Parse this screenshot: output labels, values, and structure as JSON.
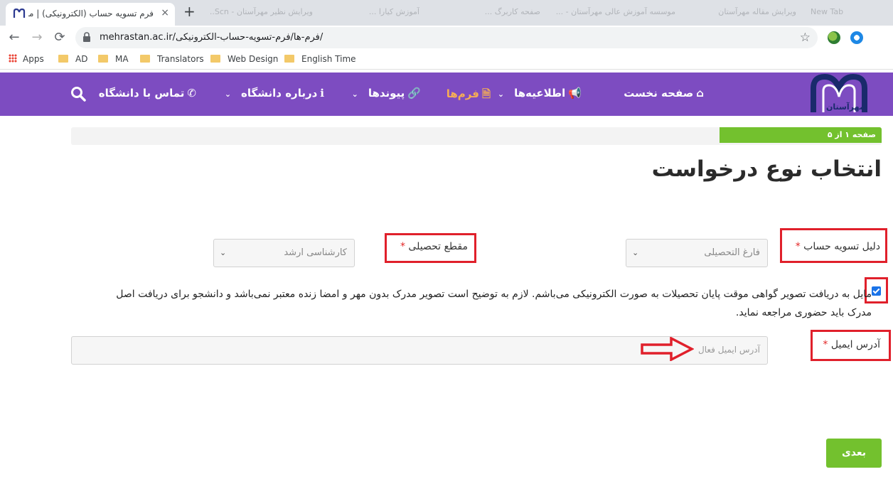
{
  "browser": {
    "active_tab_title": "فرم تسویه حساب (الکترونیکی) | موسسه آمو",
    "tab_close": "×",
    "new_tab": "+",
    "background_tabs": [
      "ویرایش نظیر مهرآستان - Scn..",
      "آموزش کیارا ...",
      "صفحه کاربرگ ...",
      "موسسه آموزش عالی مهرآستان - ...",
      "ویرایش مقاله مهرآستان",
      "New Tab"
    ],
    "url": "mehrastan.ac.ir/فرم-ها/فرم-تسویه-حساب-الکترونیکی/",
    "back": "←",
    "forward": "→",
    "reload": "⟳",
    "star": "☆"
  },
  "bookmarks": [
    {
      "label": "Apps",
      "icon": "apps-grid-icon"
    },
    {
      "label": "AD",
      "icon": "folder-icon"
    },
    {
      "label": "MA",
      "icon": "folder-icon"
    },
    {
      "label": "Translators",
      "icon": "folder-icon"
    },
    {
      "label": "Web Design",
      "icon": "folder-icon"
    },
    {
      "label": "English Time",
      "icon": "folder-icon"
    }
  ],
  "site": {
    "logo_text": "مهرآستان",
    "nav": {
      "home": "صفحه نخست",
      "news": "اطلاعیه‌ها",
      "forms": "فرم‌ها",
      "links": "پیوندها",
      "about": "درباره دانشگاه",
      "contact": "تماس با دانشگاه"
    },
    "accent": "#7d4cc1",
    "active_color": "#f6ad55"
  },
  "progress": {
    "label": "صفحه ۱ از ۵",
    "fraction": 0.2,
    "color": "#73c12e"
  },
  "form": {
    "title": "انتخاب نوع درخواست",
    "reason_label": "دلیل تسویه حساب",
    "reason_value": "فارغ التحصیلی",
    "degree_label": "مقطع تحصیلی",
    "degree_value": "کارشناسی ارشد",
    "required_mark": "*",
    "consent_checked": true,
    "consent_text": "مایل به دریافت تصویر گواهی موقت پایان تحصیلات به صورت الکترونیکی می‌باشم. لازم به توضیح است تصویر مدرک بدون مهر و امضا زنده معتبر نمی‌باشد و دانشجو برای دریافت اصل مدرک باید حضوری مراجعه نماید.",
    "email_label": "آدرس ایمیل",
    "email_placeholder": "آدرس ایمیل فعال",
    "next_button": "بعدی"
  }
}
